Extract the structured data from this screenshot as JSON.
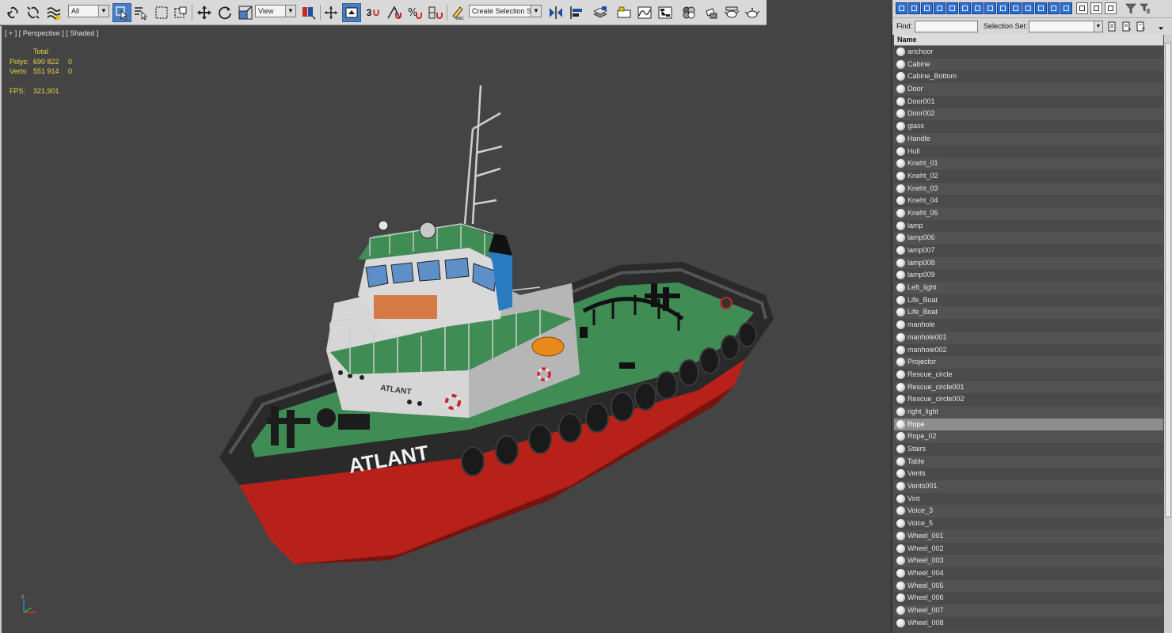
{
  "toolbar": {
    "filter_dropdown": "All",
    "ref_coord_dropdown": "View",
    "snap_label": "3",
    "selection_set_dropdown": "Create Selection Se"
  },
  "viewport": {
    "label": "[ + ] [ Perspective ] [ Shaded ]",
    "stats": {
      "header": "Total",
      "polys_label": "Polys:",
      "polys_value": "690 822",
      "polys_sel": "0",
      "verts_label": "Verts:",
      "verts_value": "551 914",
      "verts_sel": "0",
      "fps_label": "FPS:",
      "fps_value": "321,901"
    },
    "hull_text": "ATLANT",
    "cabin_text": "ATLANT",
    "axis_label": "z"
  },
  "explorer": {
    "find_label": "Find:",
    "selection_set_label": "Selection Set:",
    "column_header": "Name",
    "selected_item": "Rope",
    "items": [
      "anchoor",
      "Cabine",
      "Cabine_Bottom",
      "Door",
      "Door001",
      "Door002",
      "glass",
      "Handle",
      "Hull",
      "Kneht_01",
      "Kneht_02",
      "Kneht_03",
      "Kneht_04",
      "Kneht_05",
      "lamp",
      "lamp006",
      "lamp007",
      "lamp008",
      "lamp009",
      "Left_light",
      "Life_Boat",
      "Life_Boat",
      "manhole",
      "manhole001",
      "manhole002",
      "Projector",
      "Rescue_circle",
      "Rescue_circle001",
      "Rescue_circle002",
      "right_light",
      "Rope",
      "Rope_02",
      "Stairs",
      "Table",
      "Vents",
      "Vents001",
      "Vint",
      "Voice_3",
      "Voice_5",
      "Wheel_001",
      "Wheel_002",
      "Wheel_003",
      "Wheel_004",
      "Wheel_005",
      "Wheel_006",
      "Wheel_007",
      "Wheel_008"
    ]
  },
  "colors": {
    "viewport_bg": "#444444",
    "stats_text": "#e8d24a",
    "hull_red": "#b8201a",
    "deck_green": "#3f8c55",
    "toolbar_bg": "#d9d9d9",
    "accent_blue": "#2f6fd0"
  }
}
